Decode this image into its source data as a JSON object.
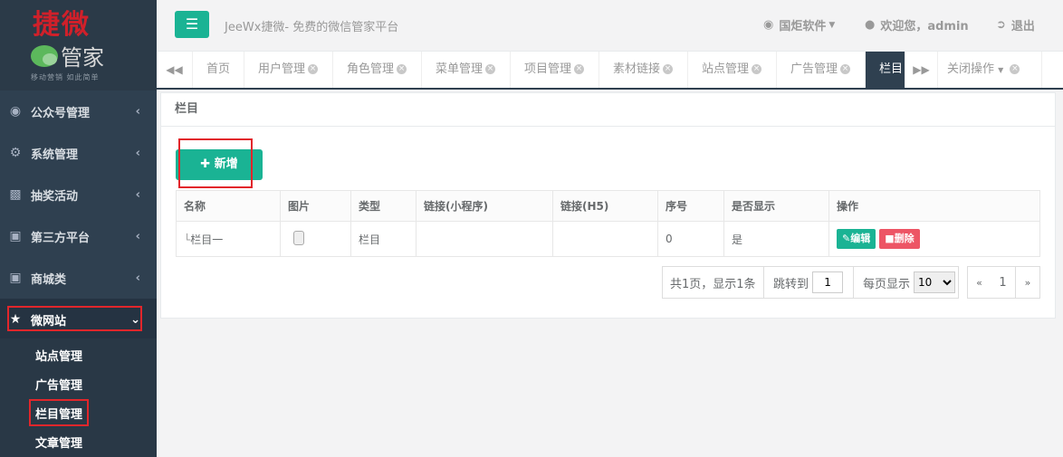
{
  "logo": {
    "line1": "捷微",
    "line2": "管家",
    "tagline": "移动营销  如此简单"
  },
  "sidebar": {
    "items": [
      {
        "icon": "wechat-icon",
        "label": "公众号管理"
      },
      {
        "icon": "gear-icon",
        "label": "系统管理"
      },
      {
        "icon": "gift-icon",
        "label": "抽奖活动"
      },
      {
        "icon": "cart-icon",
        "label": "第三方平台"
      },
      {
        "icon": "cart-icon",
        "label": "商城类"
      },
      {
        "icon": "star-icon",
        "label": "微网站"
      }
    ],
    "sub_items": [
      "站点管理",
      "广告管理",
      "栏目管理",
      "文章管理"
    ]
  },
  "header": {
    "title": "JeeWx捷微- 免费的微信管家平台",
    "org": "国炬软件",
    "welcome": "欢迎您，admin",
    "logout": "退出"
  },
  "tabs": [
    {
      "label": "首页",
      "closable": false
    },
    {
      "label": "用户管理",
      "closable": true
    },
    {
      "label": "角色管理",
      "closable": true
    },
    {
      "label": "菜单管理",
      "closable": true
    },
    {
      "label": "项目管理",
      "closable": true
    },
    {
      "label": "素材链接",
      "closable": true
    },
    {
      "label": "站点管理",
      "closable": true
    },
    {
      "label": "广告管理",
      "closable": true
    },
    {
      "label": "栏目",
      "closable": false
    }
  ],
  "tabs_close_ops": "关闭操作",
  "panel": {
    "title": "栏目",
    "add_label": "新增",
    "columns": [
      "名称",
      "图片",
      "类型",
      "链接(小程序)",
      "链接(H5)",
      "序号",
      "是否显示",
      "操作"
    ],
    "rows": [
      {
        "name": "栏目一",
        "type": "栏目",
        "link_mini": "",
        "link_h5": "",
        "order": "0",
        "show": "是"
      }
    ],
    "edit_label": "编辑",
    "delete_label": "删除"
  },
  "pagination": {
    "summary": "共1页，显示1条",
    "jump_label": "跳转到",
    "jump_value": "1",
    "per_page_label": "每页显示",
    "per_page_value": "10",
    "prev": "«",
    "current": "1",
    "next": "»"
  },
  "colors": {
    "sidebar": "#2f4050",
    "accent": "#1ab394",
    "danger": "#ed5565",
    "highlight": "#e2262b"
  }
}
